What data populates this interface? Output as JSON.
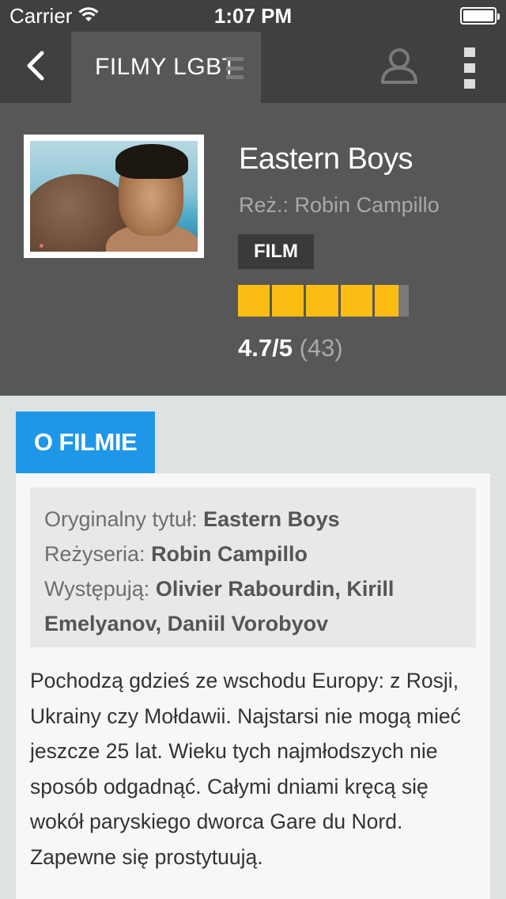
{
  "status_bar": {
    "carrier": "Carrier",
    "time": "1:07 PM"
  },
  "nav": {
    "section_title": "FILMY LGBT",
    "icons": [
      "chevron-left-icon",
      "menu-icon",
      "user-icon",
      "more-icon"
    ]
  },
  "film": {
    "title": "Eastern Boys",
    "director_line": "Reż.: Robin Campillo",
    "type_badge": "FILM",
    "rating_fraction": 0.94,
    "rating_score": "4.7/5",
    "rating_count": "(43)",
    "colors": {
      "rating_fill": "#fbbd13",
      "rating_empty": "#7a7a7a"
    }
  },
  "about": {
    "tab_label": "O FILMIE",
    "tab_color": "#1f97e8",
    "original_title_label": "Oryginalny tytuł:",
    "original_title_value": "Eastern Boys",
    "directed_label": "Reżyseria:",
    "directed_value": "Robin Campillo",
    "cast_label": "Występują:",
    "cast_value": "Olivier Rabourdin, Kirill Emelyanov, Daniil Vorobyov",
    "description": "Pochodzą gdzieś ze wschodu Europy: z Rosji, Ukrainy czy Mołdawii. Najstarsi nie mogą mieć jeszcze 25 lat. Wieku tych najmłodszych nie sposób odgadnąć. Całymi dniami kręcą się wokół paryskiego dworca Gare du Nord. Zapewne się prostytuują."
  }
}
